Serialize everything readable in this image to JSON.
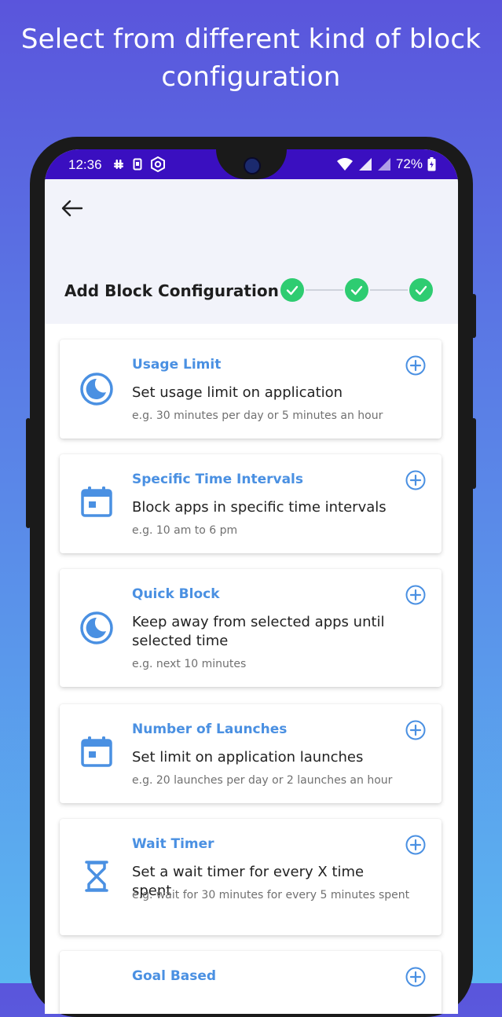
{
  "headline": "Select from different kind of block configuration",
  "status_bar": {
    "time": "12:36",
    "battery": "72%"
  },
  "screen": {
    "title": "Add Block Configuration",
    "steps_completed": 3
  },
  "cards": [
    {
      "title": "Usage Limit",
      "description": "Set usage limit on application",
      "example": "e.g. 30 minutes per day or 5 minutes an hour",
      "icon": "clock-icon"
    },
    {
      "title": "Specific Time Intervals",
      "description": "Block apps in specific time intervals",
      "example": "e.g. 10 am to 6 pm",
      "icon": "calendar-icon"
    },
    {
      "title": "Quick Block",
      "description": "Keep away from selected apps until selected time",
      "example": "e.g. next 10 minutes",
      "icon": "clock-icon"
    },
    {
      "title": "Number of Launches",
      "description": "Set limit on application launches",
      "example": "e.g. 20 launches per day or 2 launches an hour",
      "icon": "calendar-icon"
    },
    {
      "title": "Wait Timer",
      "description": "Set a wait timer for every X time spent",
      "example": "e.g. wait for 30 minutes for every 5 minutes spent",
      "icon": "hourglass-icon"
    },
    {
      "title": "Goal Based",
      "description": "",
      "example": "",
      "icon": "target-icon"
    }
  ],
  "colors": {
    "accent": "#4a90e2",
    "check": "#2ecc71",
    "status_bar": "#3a0fc0"
  }
}
